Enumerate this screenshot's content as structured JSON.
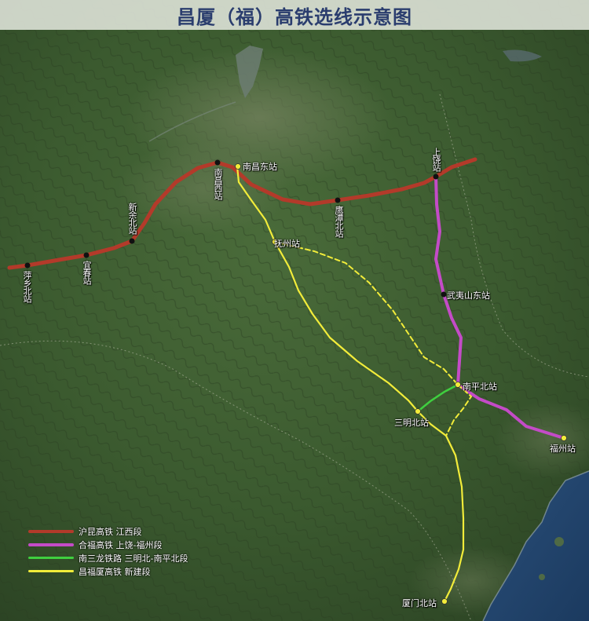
{
  "title": "昌厦（福）高铁选线示意图",
  "colors": {
    "hukun": "#b33a2a",
    "hefu": "#c44bc7",
    "nansan": "#3fcf3f",
    "new_line": "#f2ec3a"
  },
  "stations": {
    "pingxiang_north": "萍乡北站",
    "yichun": "宜春站",
    "xinyu_north": "新余北站",
    "nanchang_west": "南昌西站",
    "nanchang_east": "南昌东站",
    "yingtan_north": "鹰潭北站",
    "shangrao": "上饶站",
    "fuzhou_jx": "抚州站",
    "wuyishan_east": "武夷山东站",
    "nanping_north": "南平北站",
    "sanming_north": "三明北站",
    "fuzhou": "福州站",
    "xiamen_north": "厦门北站"
  },
  "legend": [
    {
      "label": "沪昆高铁 江西段",
      "color": "#b33a2a"
    },
    {
      "label": "合福高铁 上饶-福州段",
      "color": "#c44bc7"
    },
    {
      "label": "南三龙铁路 三明北-南平北段",
      "color": "#3fcf3f"
    },
    {
      "label": "昌福厦高铁 新建段",
      "color": "#f2ec3a"
    }
  ]
}
